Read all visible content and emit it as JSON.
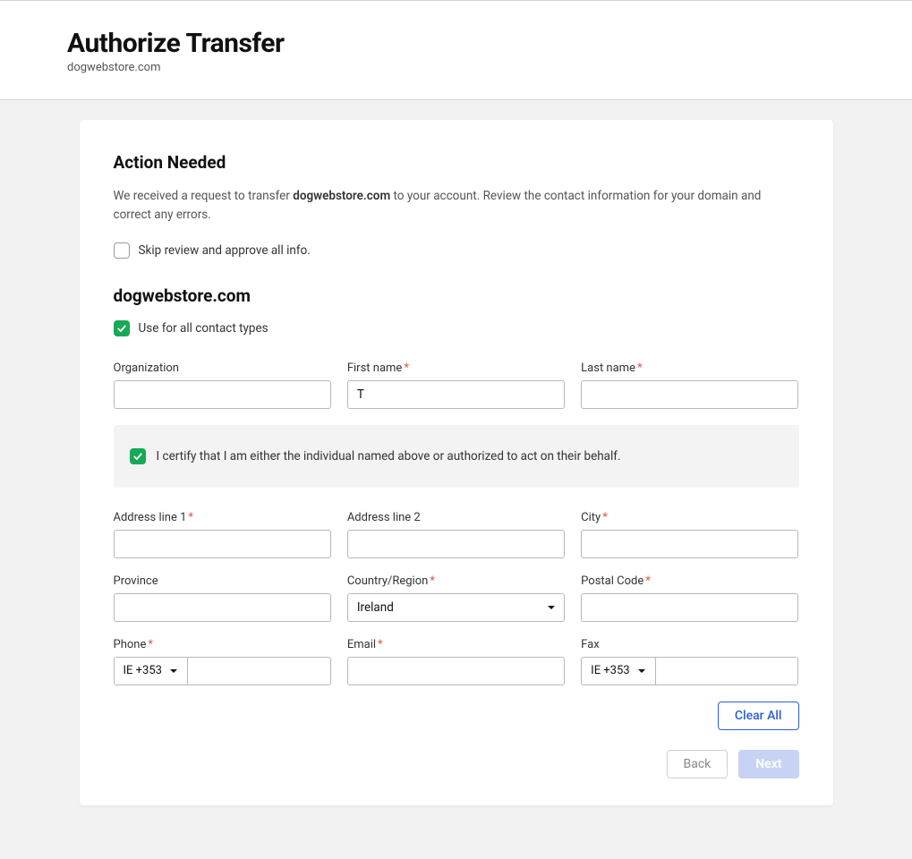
{
  "header": {
    "title": "Authorize Transfer",
    "subtitle": "dogwebstore.com"
  },
  "section": {
    "title": "Action Needed",
    "intro_pre": "We received a request to transfer ",
    "intro_domain": "dogwebstore.com",
    "intro_post": " to your account. Review the contact information for your domain and correct any errors.",
    "skip_label": "Skip review and approve all info."
  },
  "domain": {
    "name": "dogwebstore.com",
    "use_all_label": "Use for all contact types"
  },
  "fields": {
    "organization": {
      "label": "Organization",
      "value": ""
    },
    "first_name": {
      "label": "First name",
      "value": "T"
    },
    "last_name": {
      "label": "Last name",
      "value": ""
    },
    "address1": {
      "label": "Address line 1",
      "value": ""
    },
    "address2": {
      "label": "Address line 2",
      "value": ""
    },
    "city": {
      "label": "City",
      "value": ""
    },
    "province": {
      "label": "Province",
      "value": ""
    },
    "country": {
      "label": "Country/Region",
      "value": "Ireland"
    },
    "postal": {
      "label": "Postal Code",
      "value": ""
    },
    "phone": {
      "label": "Phone",
      "prefix": "IE +353",
      "value": ""
    },
    "email": {
      "label": "Email",
      "value": ""
    },
    "fax": {
      "label": "Fax",
      "prefix": "IE +353",
      "value": ""
    }
  },
  "certify": {
    "label": "I certify that I am either the individual named above or authorized to act on their behalf."
  },
  "buttons": {
    "clear_all": "Clear All",
    "back": "Back",
    "next": "Next"
  }
}
